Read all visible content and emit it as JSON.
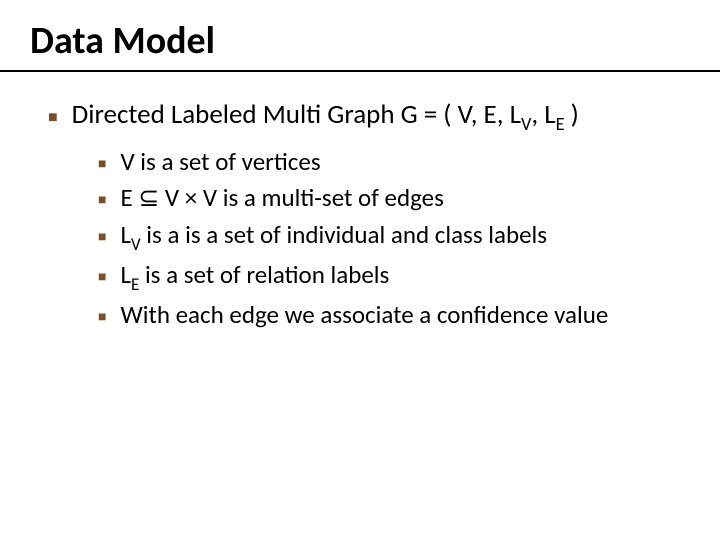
{
  "title": "Data Model",
  "main": {
    "heading_pre": "Directed Labeled Multi Graph G = ( V, E, L",
    "heading_sub1": "V",
    "heading_mid": ", L",
    "heading_sub2": "E",
    "heading_post": " )"
  },
  "items": {
    "i1": "V is a set of vertices",
    "i2_pre": "E  ",
    "i2_sym": "⊆",
    "i2_post": " V × V is a multi-set of edges",
    "i3_pre": "L",
    "i3_sub": "V",
    "i3_post": " is a is a set of  individual and class labels",
    "i4_pre": "L",
    "i4_sub": "E",
    "i4_post": " is a set of relation labels",
    "i5": "With each edge we associate a confidence value"
  }
}
